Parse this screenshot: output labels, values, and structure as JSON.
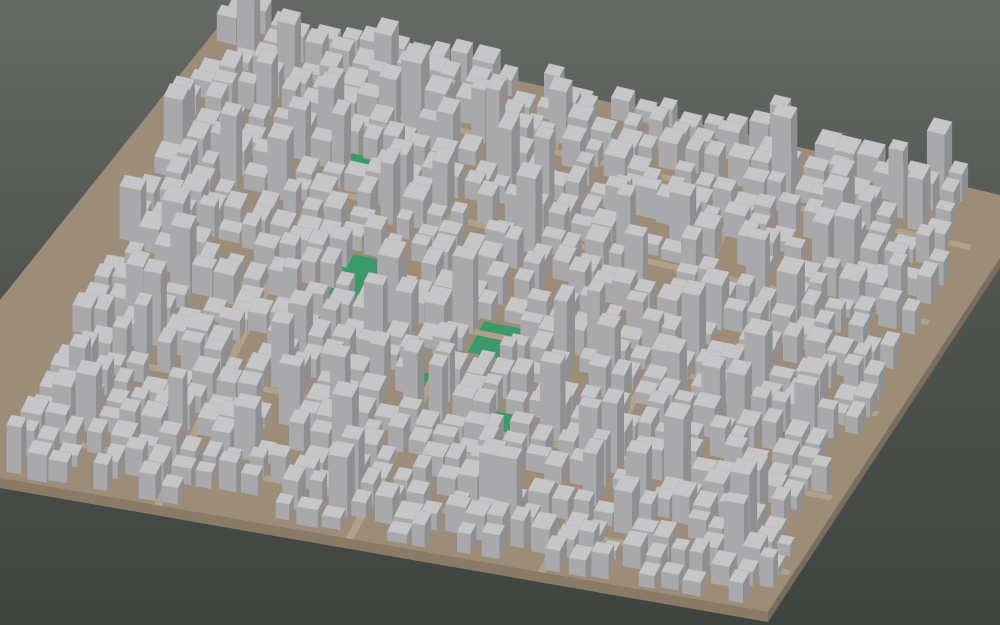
{
  "scene": {
    "kind": "3d-city-block-model",
    "colors": {
      "background_top": "#666a66",
      "background_bottom": "#3f4440",
      "ground": "#9d8d78",
      "base_side": "#8f806c",
      "building_top": "#c6c6c8",
      "building_left": "#a9a9ab",
      "building_right": "#8f8f92",
      "park": "#3c9a6a"
    }
  }
}
